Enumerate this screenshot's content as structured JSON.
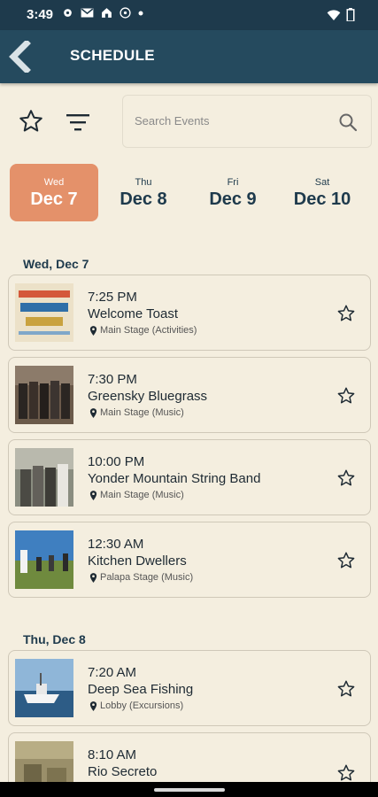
{
  "status_bar": {
    "time": "3:49"
  },
  "header": {
    "title": "SCHEDULE"
  },
  "search": {
    "placeholder": "Search Events"
  },
  "day_tabs": [
    {
      "dow": "Wed",
      "date": "Dec 7",
      "active": true
    },
    {
      "dow": "Thu",
      "date": "Dec 8",
      "active": false
    },
    {
      "dow": "Fri",
      "date": "Dec 9",
      "active": false
    },
    {
      "dow": "Sat",
      "date": "Dec 10",
      "active": false
    }
  ],
  "sections": [
    {
      "header": "Wed, Dec 7",
      "events": [
        {
          "time": "7:25 PM",
          "name": "Welcome Toast",
          "location": "Main Stage (Activities)"
        },
        {
          "time": "7:30 PM",
          "name": "Greensky Bluegrass",
          "location": "Main Stage (Music)"
        },
        {
          "time": "10:00 PM",
          "name": "Yonder Mountain String Band",
          "location": "Main Stage (Music)"
        },
        {
          "time": "12:30 AM",
          "name": "Kitchen Dwellers",
          "location": "Palapa Stage (Music)"
        }
      ]
    },
    {
      "header": "Thu, Dec 8",
      "events": [
        {
          "time": "7:20 AM",
          "name": "Deep Sea Fishing",
          "location": "Lobby (Excursions)"
        },
        {
          "time": "8:10 AM",
          "name": "Rio Secreto",
          "location": ""
        }
      ]
    }
  ],
  "colors": {
    "header_bg": "#254a5e",
    "status_bg": "#1e3a4c",
    "accent": "#e4916a",
    "page_bg": "#f4eedf",
    "text_dark": "#1e3a4c"
  },
  "icons": [
    "back-arrow-icon",
    "star-outline-icon",
    "filter-icon",
    "search-icon",
    "location-pin-icon"
  ]
}
